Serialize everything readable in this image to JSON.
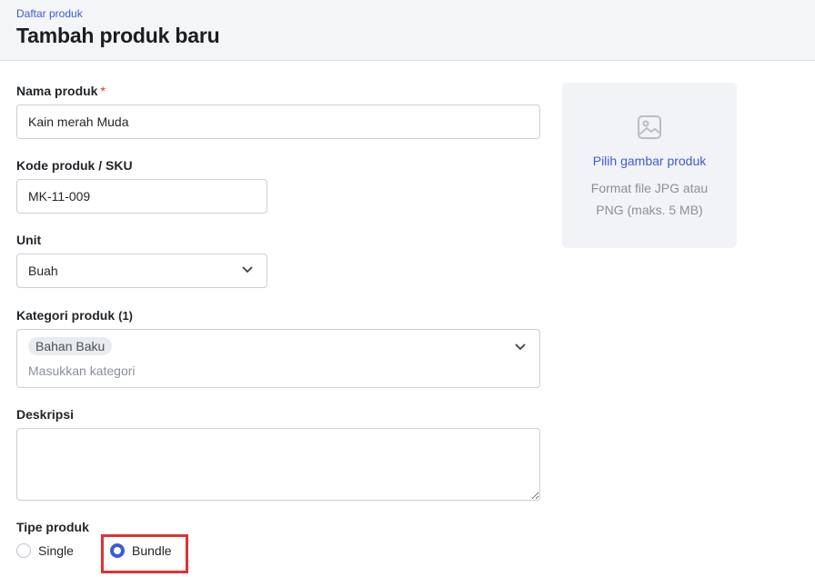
{
  "header": {
    "breadcrumb": "Daftar produk",
    "title": "Tambah produk baru"
  },
  "form": {
    "name": {
      "label": "Nama produk",
      "required_mark": "*",
      "value": "Kain merah Muda"
    },
    "sku": {
      "label": "Kode produk / SKU",
      "value": "MK-11-009"
    },
    "unit": {
      "label": "Unit",
      "value": "Buah"
    },
    "category": {
      "label": "Kategori produk",
      "count": "(1)",
      "chips": [
        "Bahan Baku"
      ],
      "placeholder": "Masukkan kategori"
    },
    "description": {
      "label": "Deskripsi",
      "value": ""
    },
    "type": {
      "label": "Tipe produk",
      "options": [
        {
          "label": "Single",
          "checked": false
        },
        {
          "label": "Bundle",
          "checked": true
        }
      ]
    }
  },
  "uploader": {
    "link": "Pilih gambar produk",
    "hint": "Format file JPG atau PNG (maks. 5 MB)"
  },
  "colors": {
    "accent": "#3b5bdb",
    "highlight": "#e03131"
  }
}
